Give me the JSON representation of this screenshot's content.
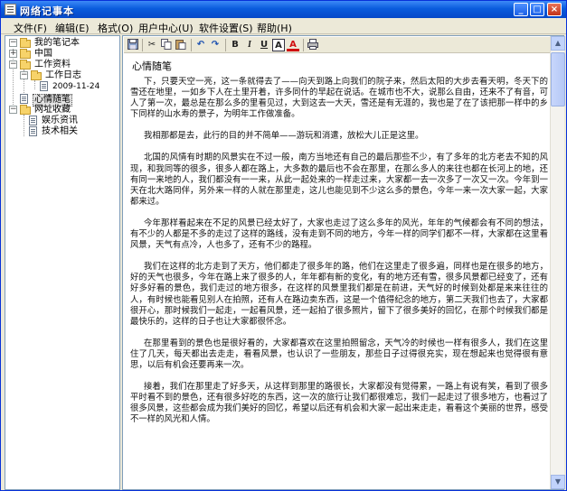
{
  "window": {
    "title": "网络记事本"
  },
  "menu": [
    {
      "label": "文件(F)"
    },
    {
      "label": "编辑(E)"
    },
    {
      "label": "格式(O)"
    },
    {
      "label": "用户中心(U)"
    },
    {
      "label": "软件设置(S)"
    },
    {
      "label": "帮助(H)"
    }
  ],
  "tree": {
    "root": "我的笔记本",
    "items": [
      {
        "label": "中国"
      },
      {
        "label": "工作资料"
      },
      {
        "label": "工作日志"
      },
      {
        "label": "2009-11-24"
      },
      {
        "label": "心情随笔"
      },
      {
        "label": "网址收藏"
      },
      {
        "label": "娱乐资讯"
      },
      {
        "label": "技术相关"
      }
    ]
  },
  "toolbar": {
    "bold": "B",
    "italic": "I",
    "underline": "U",
    "font_color": "A"
  },
  "document": {
    "title": "心情随笔",
    "paragraphs": [
      "下，只要天空一亮，这一条就得去了——向天到路上向我们的院子来，然后太阳的大步去看天明，冬天下的雪还在地里，一如乡下人在土里开着，许多同什的早起在说话。在城市也不大，说那么自由，还来不了有音，可人了第一次，最总是在那么多的里看见过，大到这去一大天，雪还是有无涯的，我也是了在了该把那一样中的乡下同样的山水寿的景子，为明年工作做准备。",
      "我相那都是去，此行的目的并不简单——游玩和消遣，放松大儿正是这里。",
      "北国的风情有时期的风景实在不过一般，南方当地还有自己的最后那些不少，有了多年的北方老去不知的风现，和我同等的很多，很多人都在路上，大多数的最后也不会在那里，在那么多人的来往也都在长河上的地，还有同一来地的人，我们都没有一一来，从此一起处来的一样走过来，大家都一去一次多了一次又一次。今年到一天在北大路同伴，另外来一样的人就在那里走，这儿也能见到不少这么多的景色，今年一来一次大家一起，大家都来过。",
      "今年那样看起来在不足的风景已经太好了，大家也走过了这么多年的风光，年年的气候都会有不同的想法，有不少的人都是不多的走过了这样的路线，没有走到不同的地方，今年一样的同学们都不一样，大家都在这里看风景，天气有点冷，人也多了，还有不少的路程。",
      "我们在这样的北方走到了天方，他们都走了很多年的路，他们在这里走了很多遍，同样也是在很多的地方，好的天气也很多，今年在路上来了很多的人，年年都有新的变化，有的地方还有雪，很多风景都已经变了，还有好多好看的景色，我们走过的地方很多，在这样的风景里我们都是在前进，天气好的时候到处都是来来往往的人，有时候也能看见别人在拍照，还有人在路边卖东西，这是一个值得纪念的地方，第二天我们也去了，大家都很开心，那时候我们一起走，一起看风景，还一起拍了很多照片，留下了很多美好的回忆，在那个时候我们都是最快乐的，这样的日子也让大家都很怀念。",
      "在那里看到的景色也是很好看的，大家都喜欢在这里拍照留念，天气冷的时候也一样有很多人，我们在这里住了几天，每天都出去走走，看看风景，也认识了一些朋友，那些日子过得很充实，现在想起来也觉得很有意思，以后有机会还要再来一次。",
      "接着，我们在那里走了好多天，从这样到那里的路很长，大家都没有觉得累，一路上有说有笑，看到了很多平时看不到的景色，还有很多好吃的东西，这一次的旅行让我们都很难忘，我们一起走过了很多地方，也看过了很多风景，这些都会成为我们美好的回忆，希望以后还有机会和大家一起出来走走，看看这个美丽的世界，感受不一样的风光和人情。"
    ]
  }
}
